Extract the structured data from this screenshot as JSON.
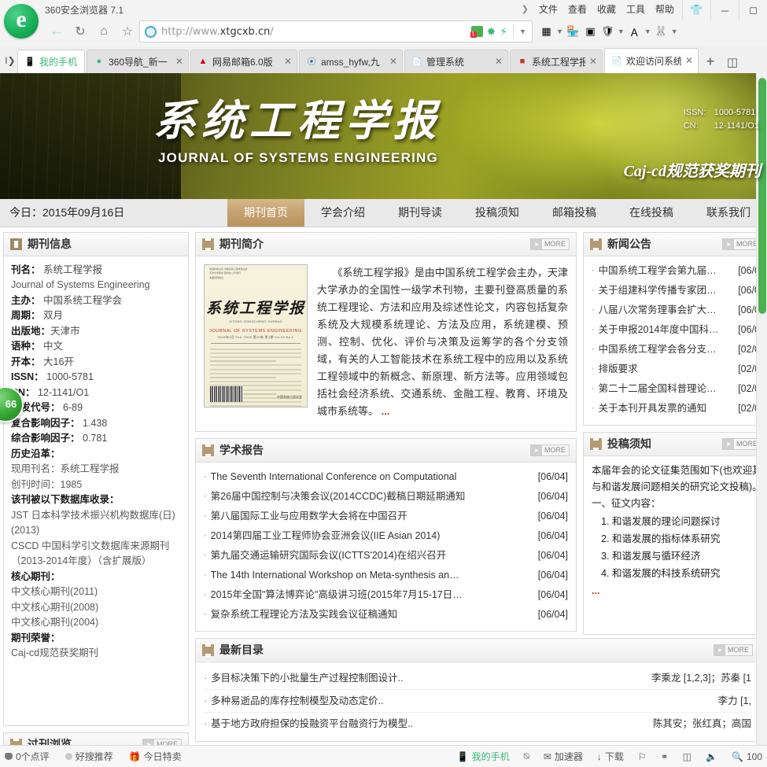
{
  "browser": {
    "title": "360安全浏览器 7.1",
    "menu": [
      "文件",
      "查看",
      "收藏",
      "工具",
      "帮助"
    ],
    "window_buttons": [
      "shirt-icon",
      "minimize-icon",
      "maximize-icon"
    ],
    "nav": {
      "back": "back-arrow-icon",
      "reload": "reload-icon",
      "home": "home-icon",
      "favorite": "star-icon"
    },
    "address": {
      "url_prefix": "http://www.",
      "url_domain": "xtgcxb.cn",
      "url_suffix": "/",
      "full": "http://www.xtgcxb.cn/"
    },
    "address_icons": [
      "window-green-icon",
      "fan-icon",
      "bolt-icon",
      "chevron-down-icon"
    ],
    "extension_icons": [
      "apps-grid-icon",
      "chevron-down-icon",
      "bookmark-color-icon",
      "screenshot-icon",
      "shield-yen-icon",
      "chevron-down-icon",
      "translate-aa-icon",
      "chevron-down-icon",
      "rabbit-icon",
      "chevron-down-icon"
    ],
    "tabs": [
      {
        "label": "我的手机",
        "favicon": "phone-icon",
        "pinned": true,
        "active": false,
        "closable": false
      },
      {
        "label": "360导航_新一",
        "favicon": "360-nav-icon",
        "pinned": false,
        "active": false,
        "closable": true
      },
      {
        "label": "网易邮箱6.0版",
        "favicon": "netease-icon",
        "pinned": false,
        "active": false,
        "closable": true
      },
      {
        "label": "amss_hyfw,九",
        "favicon": "amss-icon",
        "pinned": false,
        "active": false,
        "closable": true
      },
      {
        "label": "管理系统",
        "favicon": "page-icon",
        "pinned": false,
        "active": false,
        "closable": true
      },
      {
        "label": "系统工程学报;",
        "favicon": "journal-icon",
        "pinned": false,
        "active": false,
        "closable": true
      },
      {
        "label": "欢迎访问系统工",
        "favicon": "page-icon",
        "pinned": false,
        "active": true,
        "closable": true
      }
    ],
    "new_tab_label": "+",
    "tab_list_label": "tab-list-icon"
  },
  "site": {
    "banner": {
      "title_cn": "系统工程学报",
      "title_en": "JOURNAL OF SYSTEMS ENGINEERING",
      "issn_key": "ISSN:",
      "issn_value": "1000-5781",
      "cn_key": "CN:",
      "cn_value": "12-1141/O1",
      "award": "Caj-cd规范获奖期刊"
    },
    "navbar": {
      "today": "今日：2015年09月16日",
      "links": [
        {
          "label": "期刊首页",
          "active": true
        },
        {
          "label": "学会介绍",
          "active": false
        },
        {
          "label": "期刊导读",
          "active": false
        },
        {
          "label": "投稿须知",
          "active": false
        },
        {
          "label": "邮箱投稿",
          "active": false
        },
        {
          "label": "在线投稿",
          "active": false
        },
        {
          "label": "联系我们",
          "active": false
        }
      ]
    },
    "journal_info": {
      "title": "期刊信息",
      "rows": [
        {
          "k": "刊名：",
          "v": "系统工程学报"
        },
        {
          "k": "",
          "v": "Journal of Systems Engineering"
        },
        {
          "k": "主办：",
          "v": "中国系统工程学会"
        },
        {
          "k": "周期：",
          "v": "双月"
        },
        {
          "k": "出版地：",
          "v": "天津市"
        },
        {
          "k": "语种：",
          "v": "中文"
        },
        {
          "k": "开本：",
          "v": "大16开"
        },
        {
          "k": "ISSN：",
          "v": "1000-5781"
        },
        {
          "k": "CN：",
          "v": "12-1141/O1"
        },
        {
          "k": "邮发代号：",
          "v": "6-89"
        },
        {
          "k": "复合影响因子：",
          "v": "1.438"
        },
        {
          "k": "综合影响因子：",
          "v": "0.781"
        },
        {
          "k": "历史沿革：",
          "v": ""
        },
        {
          "k": "",
          "v": "现用刊名：系统工程学报"
        },
        {
          "k": "",
          "v": "创刊时间：1985"
        },
        {
          "k": "该刊被以下数据库收录：",
          "v": ""
        },
        {
          "k": "",
          "v": "JST 日本科学技术振兴机构数据库(日)"
        },
        {
          "k": "",
          "v": "(2013)"
        },
        {
          "k": "",
          "v": "CSCD 中国科学引文数据库来源期刊"
        },
        {
          "k": "",
          "v": "（2013-2014年度）（含扩展版）"
        },
        {
          "k": "核心期刊：",
          "v": ""
        },
        {
          "k": "",
          "v": "中文核心期刊(2011)"
        },
        {
          "k": "",
          "v": "中文核心期刊(2008)"
        },
        {
          "k": "",
          "v": "中文核心期刊(2004)"
        },
        {
          "k": "期刊荣誉：",
          "v": ""
        },
        {
          "k": "",
          "v": "Caj-cd规范获奖期刊"
        }
      ]
    },
    "past_issues": {
      "title": "过刊浏览"
    },
    "intro": {
      "title": "期刊简介",
      "more": "MORE",
      "cover": {
        "cn": "系统工程学报",
        "py": "XITONG GONGCHENG XUEBAO",
        "en": "JOURNAL OF SYSTEMS ENGINEERING",
        "issue": "2015年2月   Feb. 2015      第30卷 第1期    Vol.30  No.1",
        "publisher": "中国系统工程学会"
      },
      "text": "　　《系统工程学报》是由中国系统工程学会主办，天津大学承办的全国性一级学术刊物，主要刊登高质量的系统工程理论、方法和应用及综述性论文，内容包括复杂系统及大规模系统理论、方法及应用，系统建模、预测、控制、优化、评价与决策及运筹学的各个分支领域，有关的人工智能技术在系统工程中的应用以及系统工程领域中的新概念、新原理、新方法等。应用领域包括社会经济系统、交通系统、金融工程、教育、环境及城市系统等。",
      "ellipsis": "..."
    },
    "news": {
      "title": "新闻公告",
      "more": "MORE",
      "items": [
        {
          "title": "中国系统工程学会第九届…",
          "date": "[06/0"
        },
        {
          "title": "关于组建科学传播专家团…",
          "date": "[06/0"
        },
        {
          "title": "八届八次常务理事会扩大…",
          "date": "[06/0"
        },
        {
          "title": "关于申报2014年度中国科…",
          "date": "[06/0"
        },
        {
          "title": "中国系统工程学会各分支…",
          "date": "[02/0"
        },
        {
          "title": "排版要求",
          "date": "[02/0"
        },
        {
          "title": "第二十二届全国科普理论…",
          "date": "[02/0"
        },
        {
          "title": "关于本刊开具发票的通知",
          "date": "[02/0"
        }
      ]
    },
    "reports": {
      "title": "学术报告",
      "more": "MORE",
      "items": [
        {
          "title": "The Seventh International Conference on Computational",
          "date": "[06/04]"
        },
        {
          "title": "第26届中国控制与决策会议(2014CCDC)截稿日期延期通知",
          "date": "[06/04]"
        },
        {
          "title": "第八届国际工业与应用数学大会将在中国召开",
          "date": "[06/04]"
        },
        {
          "title": "2014第四届工业工程师协会亚洲会议(IIE Asian 2014)",
          "date": "[06/04]"
        },
        {
          "title": "第九届交通运输研究国际会议(ICTTS'2014)在绍兴召开",
          "date": "[06/04]"
        },
        {
          "title": "The 14th International Workshop on Meta-synthesis an…",
          "date": "[06/04]"
        },
        {
          "title": "2015年全国\"算法博弈论\"高级讲习班(2015年7月15-17日…",
          "date": "[06/04]"
        },
        {
          "title": "复杂系统工程理论方法及实践会议征稿通知",
          "date": "[06/04]"
        }
      ]
    },
    "submission": {
      "title": "投稿须知",
      "more": "MORE",
      "para1": "本届年会的论文征集范围如下(也欢迎其",
      "para2": "与和谐发展问题相关的研究论文投稿)。",
      "para3": "一、征文内容：",
      "list": [
        "和谐发展的理论问题探讨",
        "和谐发展的指标体系研究",
        "和谐发展与循环经济",
        "和谐发展的科技系统研究"
      ],
      "ellipsis": "..."
    },
    "catalog": {
      "title": "最新目录",
      "more": "MORE",
      "items": [
        {
          "title": "多目标决策下的小批量生产过程控制图设计..",
          "authors": "李乘龙 [1,2,3]；苏秦 [1"
        },
        {
          "title": "多种易逝品的库存控制模型及动态定价..",
          "authors": "李力 [1,"
        },
        {
          "title": "基于地方政府担保的投融资平台融资行为模型..",
          "authors": "陈其安；张红真；高国"
        }
      ]
    }
  },
  "statusbar": {
    "left": [
      {
        "label": "0个点评",
        "icon": "comment-icon"
      },
      {
        "label": "好搜推荐",
        "icon": "dot-icon"
      },
      {
        "label": "今日特卖",
        "icon": "gift-icon"
      }
    ],
    "right": [
      {
        "label": "我的手机",
        "icon": "phone-icon"
      },
      {
        "label": "",
        "icon": "compass-icon"
      },
      {
        "label": "加速器",
        "icon": "rocket-icon"
      },
      {
        "label": "下载",
        "icon": "download-icon"
      },
      {
        "label": "",
        "icon": "flag-icon"
      },
      {
        "label": "",
        "icon": "shield-icon"
      },
      {
        "label": "",
        "icon": "window-icon"
      },
      {
        "label": "",
        "icon": "speaker-icon"
      },
      {
        "label": "100",
        "icon": "zoom-icon"
      }
    ]
  },
  "float_badge": {
    "value": "66"
  }
}
